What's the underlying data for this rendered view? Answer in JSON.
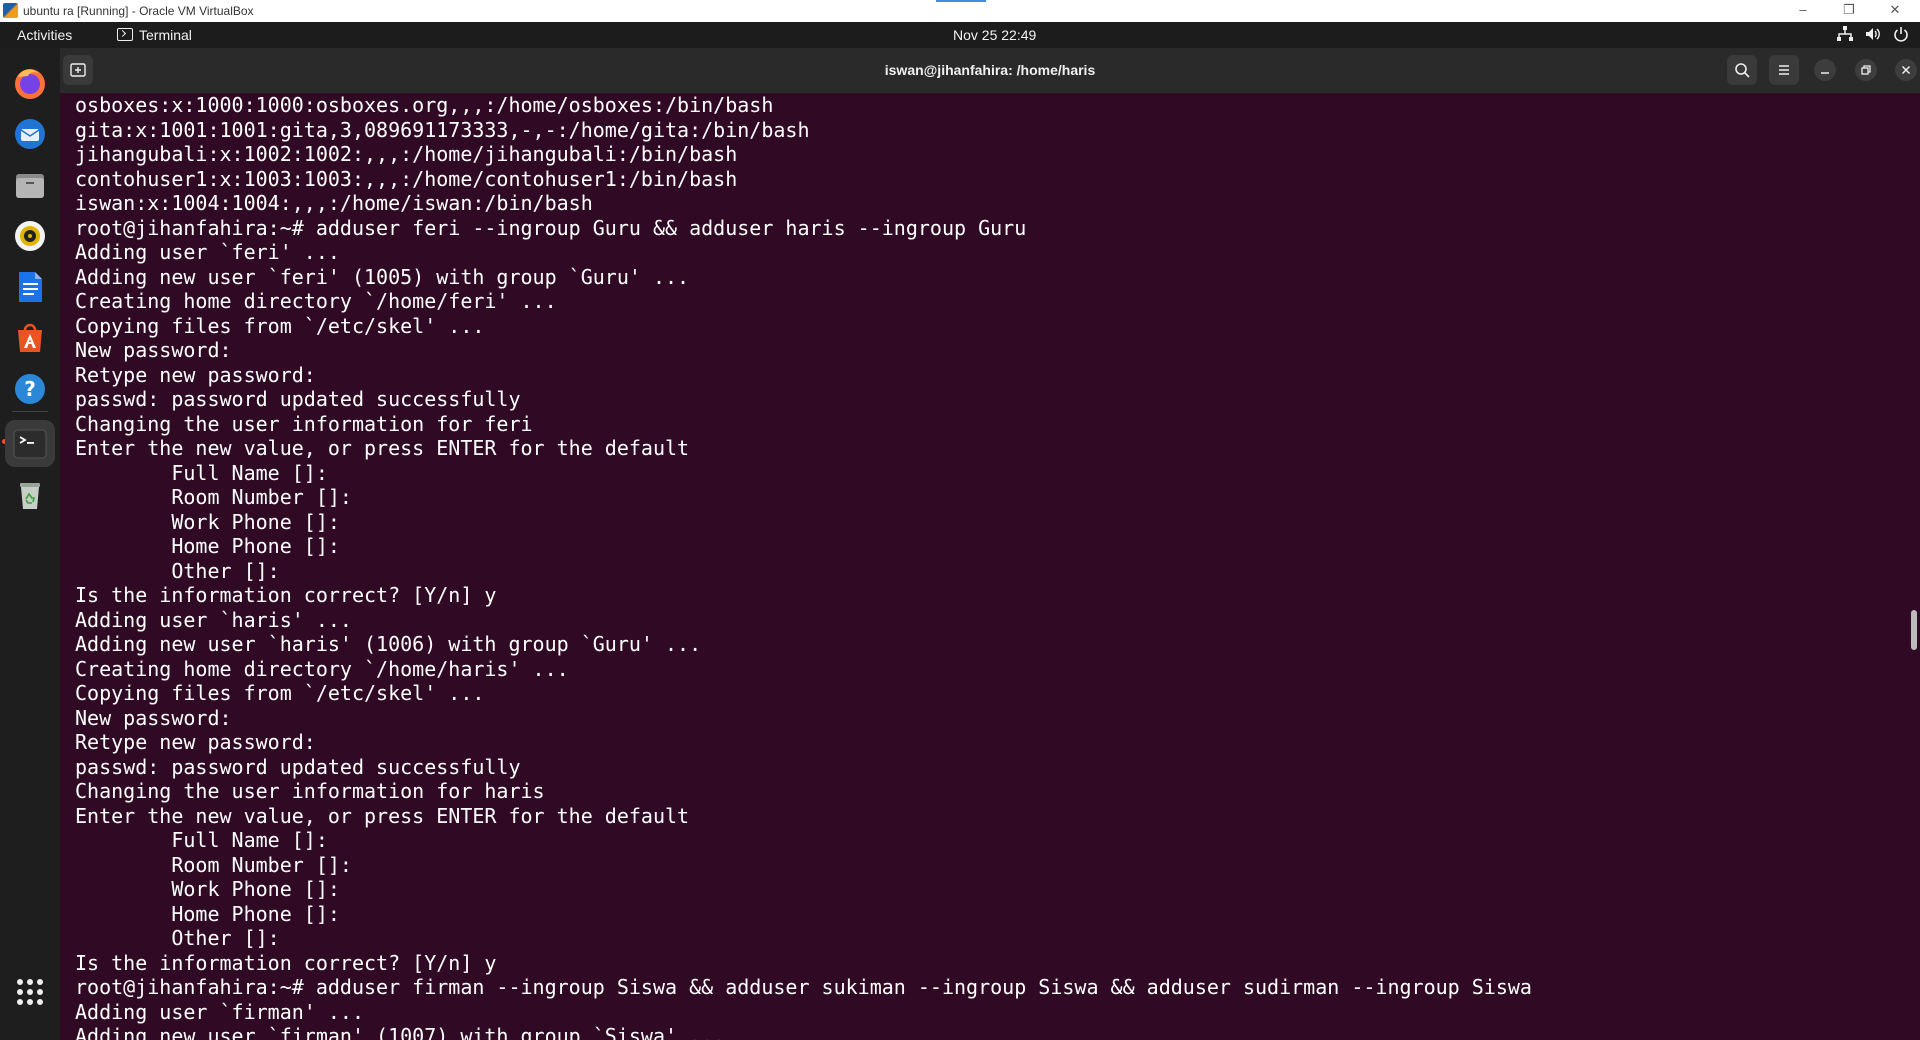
{
  "vbox": {
    "title": "ubuntu ra [Running] - Oracle VM VirtualBox",
    "minimize": "–",
    "restore": "❐",
    "close": "✕"
  },
  "topbar": {
    "activities": "Activities",
    "app_name": "Terminal",
    "clock": "Nov 25  22:49"
  },
  "dock": {
    "items": [
      "firefox-icon",
      "thunderbird-icon",
      "files-icon",
      "rhythmbox-icon",
      "libreoffice-writer-icon",
      "app-center-icon",
      "help-icon",
      "terminal-icon",
      "trash-icon",
      "show-apps-icon"
    ]
  },
  "terminal": {
    "title": "iswan@jihanfahira: /home/haris",
    "lines": [
      "osboxes:x:1000:1000:osboxes.org,,,:/home/osboxes:/bin/bash",
      "gita:x:1001:1001:gita,3,089691173333,-,-:/home/gita:/bin/bash",
      "jihangubali:x:1002:1002:,,,:/home/jihangubali:/bin/bash",
      "contohuser1:x:1003:1003:,,,:/home/contohuser1:/bin/bash",
      "iswan:x:1004:1004:,,,:/home/iswan:/bin/bash",
      "root@jihanfahira:~# adduser feri --ingroup Guru && adduser haris --ingroup Guru",
      "Adding user `feri' ...",
      "Adding new user `feri' (1005) with group `Guru' ...",
      "Creating home directory `/home/feri' ...",
      "Copying files from `/etc/skel' ...",
      "New password:",
      "Retype new password:",
      "passwd: password updated successfully",
      "Changing the user information for feri",
      "Enter the new value, or press ENTER for the default",
      "        Full Name []:",
      "        Room Number []:",
      "        Work Phone []:",
      "        Home Phone []:",
      "        Other []:",
      "Is the information correct? [Y/n] y",
      "Adding user `haris' ...",
      "Adding new user `haris' (1006) with group `Guru' ...",
      "Creating home directory `/home/haris' ...",
      "Copying files from `/etc/skel' ...",
      "New password:",
      "Retype new password:",
      "passwd: password updated successfully",
      "Changing the user information for haris",
      "Enter the new value, or press ENTER for the default",
      "        Full Name []:",
      "        Room Number []:",
      "        Work Phone []:",
      "        Home Phone []:",
      "        Other []:",
      "Is the information correct? [Y/n] y",
      "root@jihanfahira:~# adduser firman --ingroup Siswa && adduser sukiman --ingroup Siswa && adduser sudirman --ingroup Siswa",
      "Adding user `firman' ...",
      "Adding new user `firman' (1007) with group `Siswa' ..."
    ]
  },
  "colors": {
    "terminal_bg": "#300a24",
    "accent": "#e95420"
  }
}
